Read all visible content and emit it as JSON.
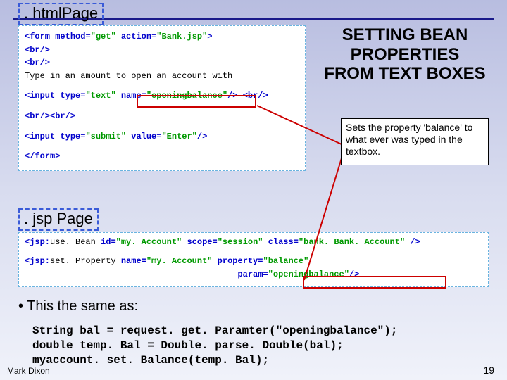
{
  "labels": {
    "htmlPage": ". htmlPage",
    "jspPage": ". jsp Page"
  },
  "title": "SETTING BEAN PROPERTIES FROM TEXT BOXES",
  "annotation": "Sets the property 'balance' to what ever was typed in the textbox.",
  "htmlCode": {
    "l1a": "<form ",
    "l1b": "method",
    "l1c": "=",
    "l1d": "\"get\"",
    "l1e": " action",
    "l1f": "=",
    "l1g": "\"Bank.jsp\"",
    "l1h": ">",
    "l2": "<br/>",
    "l3": "<br/>",
    "l4": "Type in an amount to open an account with",
    "l5a": "<input ",
    "l5b": "type",
    "l5c": "=",
    "l5d": "\"text\"",
    "l5e": " name",
    "l5f": "=",
    "l5g": "\"openingbalance\"",
    "l5h": "/>",
    "l5i": " <br/>",
    "l6": "<br/><br/>",
    "l7a": "<input ",
    "l7b": "type",
    "l7c": "=",
    "l7d": "\"submit\"",
    "l7e": " value",
    "l7f": "=",
    "l7g": "\"Enter\"",
    "l7h": "/>",
    "l8": "</form>"
  },
  "jspCode": {
    "l1a": "<jsp:",
    "l1b": "use. Bean ",
    "l1c": "id",
    "l1d": "=",
    "l1e": "\"my. Account\"",
    "l1f": " scope",
    "l1g": "=",
    "l1h": "\"session\"",
    "l1i": " class",
    "l1j": "=",
    "l1k": "\"bank. Bank. Account\"",
    "l1l": " />",
    "l2a": "<jsp:",
    "l2b": "set. Property ",
    "l2c": "name",
    "l2d": "=",
    "l2e": "\"my. Account\"",
    "l2f": " property",
    "l2g": "=",
    "l2h": "\"balance\"",
    "l3pad": "                                          ",
    "l3a": "param",
    "l3b": "=",
    "l3c": "\"openingbalance\"",
    "l3d": "/>"
  },
  "bullet": "• This the same as:",
  "equivCode": {
    "l1": "String bal = request. get. Paramter(\"openingbalance\");",
    "l2": "double temp. Bal = Double. parse. Double(bal);",
    "l3": "myaccount. set. Balance(temp. Bal);"
  },
  "footer": {
    "left": "Mark Dixon",
    "right": "19"
  }
}
